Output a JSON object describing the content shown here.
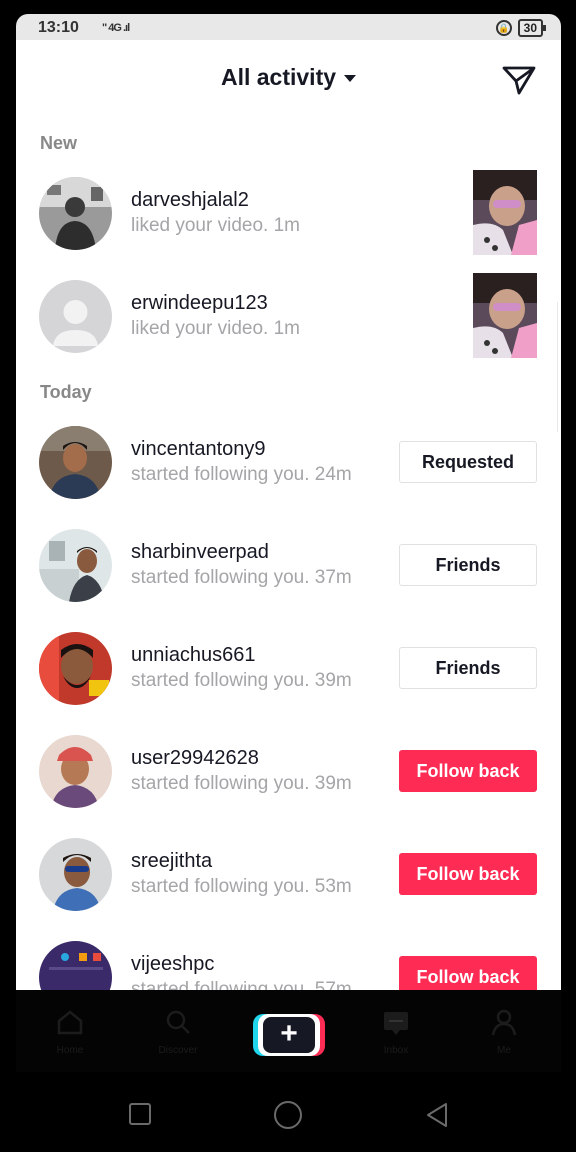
{
  "status_bar": {
    "time": "13:10",
    "signal": "\" 4G .ıl",
    "battery": "30"
  },
  "header": {
    "title": "All activity"
  },
  "sections": {
    "new": "New",
    "today": "Today"
  },
  "notifications": [
    {
      "username": "darveshjalal2",
      "action": "liked your video.",
      "time": "1m"
    },
    {
      "username": "erwindeepu123",
      "action": "liked your video.",
      "time": "1m"
    },
    {
      "username": "vincentantony9",
      "action": "started following you.",
      "time": "24m",
      "button": "Requested"
    },
    {
      "username": "sharbinveerpad",
      "action": "started following you.",
      "time": "37m",
      "button": "Friends"
    },
    {
      "username": "unniachus661",
      "action": "started following you.",
      "time": "39m",
      "button": "Friends"
    },
    {
      "username": "user29942628",
      "action": "started following you.",
      "time": "39m",
      "button": "Follow back"
    },
    {
      "username": "sreejithta",
      "action": "started following you.",
      "time": "53m",
      "button": "Follow back"
    },
    {
      "username": "vijeeshpc",
      "action": "started following you.",
      "time": "57m",
      "button": "Follow back"
    }
  ],
  "bottom_nav": {
    "home": "Home",
    "discover": "Discover",
    "create": "+",
    "inbox": "Inbox",
    "me": "Me"
  },
  "colors": {
    "accent": "#fe2c55",
    "cyan": "#20d5ec",
    "text": "#161823",
    "muted": "#a5a5a8"
  }
}
